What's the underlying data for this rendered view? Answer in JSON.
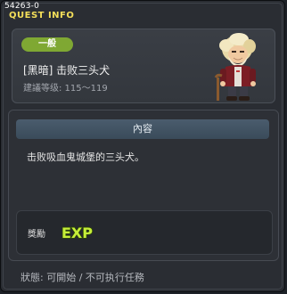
{
  "quest": {
    "id": "54263-0",
    "window_title": "QUEST INFO",
    "category": "一般",
    "name": "[黑暗] 击败三头犬",
    "level_range": "建議等级: 115〜119"
  },
  "content": {
    "header": "內容",
    "description": "击败吸血鬼城堡的三头犬。"
  },
  "reward": {
    "label": "獎勵",
    "exp_text": "EXP",
    "exp_icon": "exp-icon"
  },
  "status": {
    "text": "狀態: 可開始 / 不可执行任務"
  },
  "icons": {
    "npc": "npc-portrait-old-man",
    "exp": "exp-icon"
  },
  "colors": {
    "title": "#f4df5a",
    "badge": "#7fa833",
    "content_header": "#44566a",
    "exp_fill": "#c6ee3a"
  }
}
